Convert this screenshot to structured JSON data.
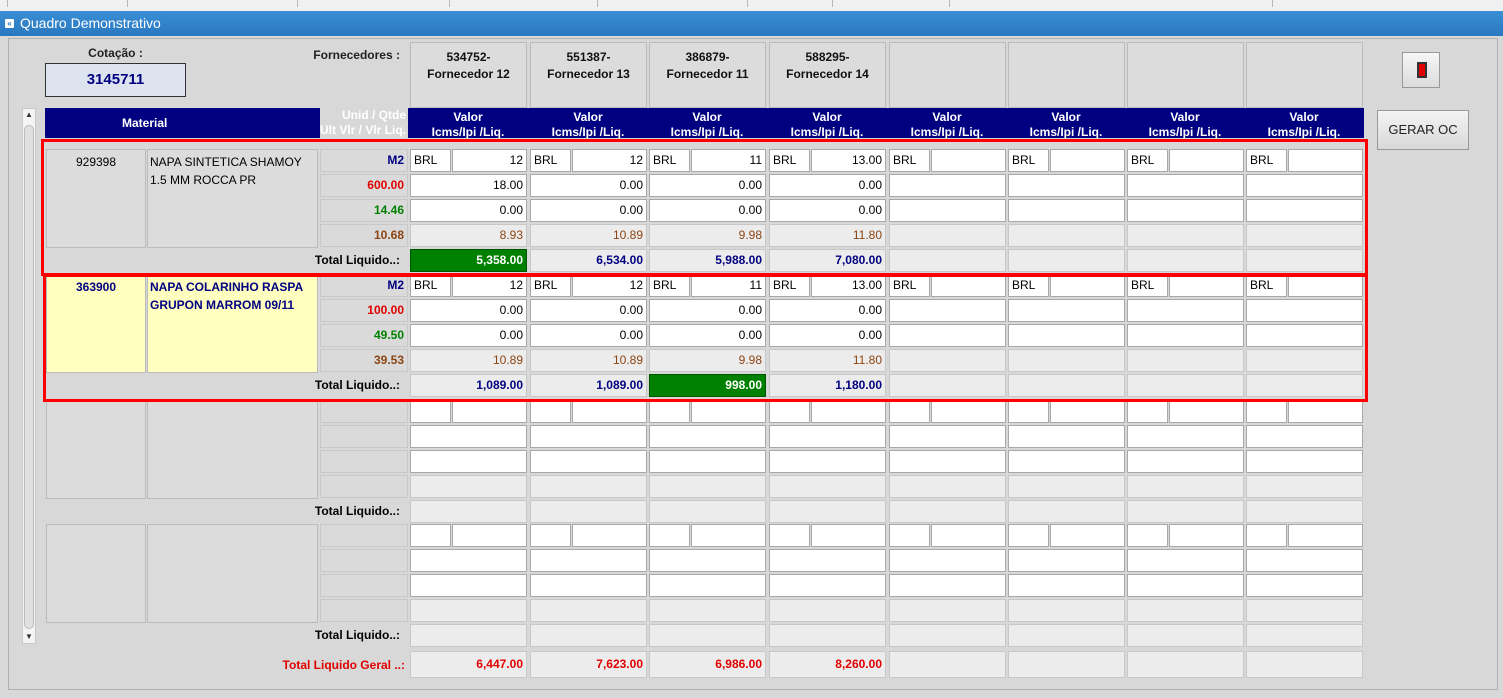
{
  "window": {
    "title": "Quadro Demonstrativo"
  },
  "cotacao": {
    "label": "Cotação :",
    "value": "3145711"
  },
  "fornecedores": {
    "label": "Fornecedores :",
    "list": [
      {
        "code": "534752-",
        "name": "Fornecedor 12"
      },
      {
        "code": "551387-",
        "name": "Fornecedor 13"
      },
      {
        "code": "386879-",
        "name": "Fornecedor 11"
      },
      {
        "code": "588295-",
        "name": "Fornecedor 14"
      },
      {
        "code": "",
        "name": ""
      },
      {
        "code": "",
        "name": ""
      },
      {
        "code": "",
        "name": ""
      },
      {
        "code": "",
        "name": ""
      }
    ]
  },
  "header": {
    "material": "Material",
    "unid_line1": "Unid / Qtde",
    "unid_line2": "Ult Vlr / Vlr Liq.",
    "valor_line1": "Valor",
    "valor_line2": "Icms/Ipi /Liq."
  },
  "buttons": {
    "gerar_oc": "GERAR OC"
  },
  "totals": {
    "total_label": "Total Liquido..:",
    "grand_label": "Total Liquido Geral ..:",
    "grand": [
      "6,447.00",
      "7,623.00",
      "6,986.00",
      "8,260.00",
      "",
      "",
      "",
      ""
    ]
  },
  "materials": [
    {
      "code": "929398",
      "description": "NAPA SINTETICA SHAMOY 1.5 MM ROCCA PR",
      "unit": "M2",
      "qtde": "600.00",
      "ult_vlr": "14.46",
      "vlr_liq": "10.68",
      "currency": [
        "BRL",
        "BRL",
        "BRL",
        "BRL",
        "BRL",
        "BRL",
        "BRL",
        "BRL"
      ],
      "price": [
        "12",
        "12",
        "11",
        "13.00",
        "",
        "",
        "",
        ""
      ],
      "icms": [
        "18.00",
        "0.00",
        "0.00",
        "0.00",
        "",
        "",
        "",
        ""
      ],
      "ipi": [
        "0.00",
        "0.00",
        "0.00",
        "0.00",
        "",
        "",
        "",
        ""
      ],
      "liq": [
        "8.93",
        "10.89",
        "9.98",
        "11.80",
        "",
        "",
        "",
        ""
      ],
      "total": [
        "5,358.00",
        "6,534.00",
        "5,988.00",
        "7,080.00",
        "",
        "",
        "",
        ""
      ]
    },
    {
      "code": "363900",
      "description": "NAPA COLARINHO RASPA GRUPON MARROM 09/11",
      "unit": "M2",
      "qtde": "100.00",
      "ult_vlr": "49.50",
      "vlr_liq": "39.53",
      "currency": [
        "BRL",
        "BRL",
        "BRL",
        "BRL",
        "BRL",
        "BRL",
        "BRL",
        "BRL"
      ],
      "price": [
        "12",
        "12",
        "11",
        "13.00",
        "",
        "",
        "",
        ""
      ],
      "icms": [
        "0.00",
        "0.00",
        "0.00",
        "0.00",
        "",
        "",
        "",
        ""
      ],
      "ipi": [
        "0.00",
        "0.00",
        "0.00",
        "0.00",
        "",
        "",
        "",
        ""
      ],
      "liq": [
        "10.89",
        "10.89",
        "9.98",
        "11.80",
        "",
        "",
        "",
        ""
      ],
      "total": [
        "1,089.00",
        "1,089.00",
        "998.00",
        "1,180.00",
        "",
        "",
        "",
        ""
      ]
    },
    {
      "code": "",
      "description": "",
      "unit": "",
      "qtde": "",
      "ult_vlr": "",
      "vlr_liq": "",
      "currency": [
        "",
        "",
        "",
        "",
        "",
        "",
        "",
        ""
      ],
      "price": [
        "",
        "",
        "",
        "",
        "",
        "",
        "",
        ""
      ],
      "icms": [
        "",
        "",
        "",
        "",
        "",
        "",
        "",
        ""
      ],
      "ipi": [
        "",
        "",
        "",
        "",
        "",
        "",
        "",
        ""
      ],
      "liq": [
        "",
        "",
        "",
        "",
        "",
        "",
        "",
        ""
      ],
      "total": [
        "",
        "",
        "",
        "",
        "",
        "",
        "",
        ""
      ]
    },
    {
      "code": "",
      "description": "",
      "unit": "",
      "qtde": "",
      "ult_vlr": "",
      "vlr_liq": "",
      "currency": [
        "",
        "",
        "",
        "",
        "",
        "",
        "",
        ""
      ],
      "price": [
        "",
        "",
        "",
        "",
        "",
        "",
        "",
        ""
      ],
      "icms": [
        "",
        "",
        "",
        "",
        "",
        "",
        "",
        ""
      ],
      "ipi": [
        "",
        "",
        "",
        "",
        "",
        "",
        "",
        ""
      ],
      "liq": [
        "",
        "",
        "",
        "",
        "",
        "",
        "",
        ""
      ],
      "total": [
        "",
        "",
        "",
        "",
        "",
        "",
        "",
        ""
      ]
    }
  ],
  "best_offer_index": [
    0,
    2
  ],
  "selected_cell": {
    "material": 1,
    "field": "icms",
    "supplier": 3
  },
  "colors": {
    "title_bar": "#2a78c0",
    "header_bg": "#000080",
    "best_offer": "#008000",
    "highlight_box": "#ff0000",
    "grand_total": "#e00000"
  }
}
